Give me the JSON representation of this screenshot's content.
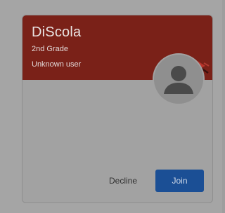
{
  "class_card": {
    "title": "DiScola",
    "section": "2nd Grade",
    "owner": "Unknown user",
    "avatar_icon": "account-circle-icon",
    "banner_decoration_icon": "theme-illustration-icon"
  },
  "actions": {
    "decline_label": "Decline",
    "join_label": "Join"
  },
  "colors": {
    "banner": "#7a2118",
    "join_button": "#1b4f95",
    "overlay_dim": "#a5a5a5"
  }
}
